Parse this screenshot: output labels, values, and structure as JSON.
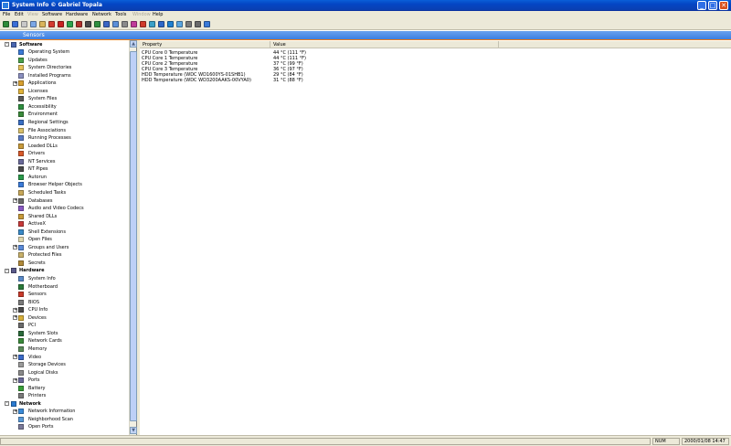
{
  "window": {
    "title": "System Info  © Gabriel Topala",
    "minimize": "_",
    "maximize": "□",
    "close": "✕"
  },
  "menu": [
    {
      "label": "File",
      "enabled": true
    },
    {
      "label": "Edit",
      "enabled": true
    },
    {
      "label": "View",
      "enabled": false
    },
    {
      "label": "Software",
      "enabled": true
    },
    {
      "label": "Hardware",
      "enabled": true
    },
    {
      "label": "Network",
      "enabled": true
    },
    {
      "label": "Tools",
      "enabled": true
    },
    {
      "label": "Window",
      "enabled": false
    },
    {
      "label": "Help",
      "enabled": true
    }
  ],
  "toolbar_icons": [
    {
      "name": "exit-icon",
      "color": "#2e8b3a"
    },
    {
      "name": "save-icon",
      "color": "#3b6fd6"
    },
    {
      "name": "cut-icon",
      "color": "#c8c8c8"
    },
    {
      "name": "copy-icon",
      "color": "#7aa7e6"
    },
    {
      "name": "paste-icon",
      "color": "#d9b45a"
    },
    {
      "name": "delete-icon",
      "color": "#d33b2f"
    },
    {
      "name": "stop-icon",
      "color": "#c82020"
    },
    {
      "name": "refresh-icon",
      "color": "#2aa34a"
    },
    {
      "name": "cpu-icon",
      "color": "#b0302a"
    },
    {
      "name": "chip-icon",
      "color": "#4a4a4a"
    },
    {
      "name": "memory-icon",
      "color": "#2f8f3f"
    },
    {
      "name": "display-icon",
      "color": "#3a66c4"
    },
    {
      "name": "network-icon",
      "color": "#5b8fd8"
    },
    {
      "name": "disk-icon",
      "color": "#8a8a8a"
    },
    {
      "name": "process-icon",
      "color": "#c03a9a"
    },
    {
      "name": "sensor-icon",
      "color": "#cf3a2a"
    },
    {
      "name": "gauge-icon",
      "color": "#3aa0c8"
    },
    {
      "name": "info-icon",
      "color": "#2d67c8"
    },
    {
      "name": "globe-icon",
      "color": "#1f7fd0"
    },
    {
      "name": "user-icon",
      "color": "#5aa5e0"
    },
    {
      "name": "settings-icon",
      "color": "#7a7a7a"
    },
    {
      "name": "printer-icon",
      "color": "#6a6a6a"
    },
    {
      "name": "help-icon",
      "color": "#3a7ad8"
    }
  ],
  "section_title": "Sensors",
  "tree": [
    {
      "label": "Software",
      "level": 0,
      "category": true,
      "expander": "-",
      "icon": "folder-software-icon",
      "color": "#4a66b0"
    },
    {
      "label": "Operating System",
      "level": 1,
      "icon": "windows-icon",
      "color": "#3c7ad6"
    },
    {
      "label": "Updates",
      "level": 1,
      "icon": "updates-icon",
      "color": "#4aa04a"
    },
    {
      "label": "System Directories",
      "level": 1,
      "icon": "folder-icon",
      "color": "#e6c25a"
    },
    {
      "label": "Installed Programs",
      "level": 1,
      "icon": "programs-icon",
      "color": "#8a8fbf"
    },
    {
      "label": "Applications",
      "level": 1,
      "expander": "+",
      "icon": "applications-icon",
      "color": "#d8a030"
    },
    {
      "label": "Licenses",
      "level": 1,
      "icon": "license-icon",
      "color": "#e0b23a"
    },
    {
      "label": "System Files",
      "level": 1,
      "icon": "system-files-icon",
      "color": "#5a5a5a"
    },
    {
      "label": "Accessibility",
      "level": 1,
      "icon": "accessibility-icon",
      "color": "#2f8f3f"
    },
    {
      "label": "Environment",
      "level": 1,
      "icon": "environment-icon",
      "color": "#3a8a3a"
    },
    {
      "label": "Regional Settings",
      "level": 1,
      "icon": "regional-icon",
      "color": "#3a6fc4"
    },
    {
      "label": "File Associations",
      "level": 1,
      "icon": "file-associations-icon",
      "color": "#d9c06a"
    },
    {
      "label": "Running Processes",
      "level": 1,
      "icon": "processes-icon",
      "color": "#5a7ac4"
    },
    {
      "label": "Loaded DLLs",
      "level": 1,
      "icon": "dll-icon",
      "color": "#c89a3a"
    },
    {
      "label": "Drivers",
      "level": 1,
      "icon": "drivers-icon",
      "color": "#d85a2a"
    },
    {
      "label": "NT Services",
      "level": 1,
      "icon": "services-icon",
      "color": "#6a6a9a"
    },
    {
      "label": "NT Pipes",
      "level": 1,
      "icon": "pipes-icon",
      "color": "#4a4a4a"
    },
    {
      "label": "Autorun",
      "level": 1,
      "icon": "autorun-icon",
      "color": "#2a9a4a"
    },
    {
      "label": "Browser Helper Objects",
      "level": 1,
      "icon": "browser-icon",
      "color": "#3a7ad8"
    },
    {
      "label": "Scheduled Tasks",
      "level": 1,
      "icon": "tasks-icon",
      "color": "#c8a85a"
    },
    {
      "label": "Databases",
      "level": 1,
      "expander": "+",
      "icon": "database-icon",
      "color": "#6a6a6a"
    },
    {
      "label": "Audio and Video Codecs",
      "level": 1,
      "icon": "codecs-icon",
      "color": "#8a5ac4"
    },
    {
      "label": "Shared DLLs",
      "level": 1,
      "icon": "shared-dll-icon",
      "color": "#c89a3a"
    },
    {
      "label": "ActiveX",
      "level": 1,
      "icon": "activex-icon",
      "color": "#c83a3a"
    },
    {
      "label": "Shell Extensions",
      "level": 1,
      "icon": "shell-icon",
      "color": "#3a8ac8"
    },
    {
      "label": "Open Files",
      "level": 1,
      "icon": "open-files-icon",
      "color": "#e0d8b0"
    },
    {
      "label": "Groups and Users",
      "level": 1,
      "expander": "+",
      "icon": "users-icon",
      "color": "#5a8ad8"
    },
    {
      "label": "Protected Files",
      "level": 1,
      "icon": "protected-icon",
      "color": "#c8b06a"
    },
    {
      "label": "Secrets",
      "level": 1,
      "icon": "secrets-icon",
      "color": "#b08a3a"
    },
    {
      "label": "Hardware",
      "level": 0,
      "category": true,
      "expander": "-",
      "icon": "hardware-icon",
      "color": "#5a5a8a"
    },
    {
      "label": "System Info",
      "level": 1,
      "icon": "system-info-icon",
      "color": "#5a8ac8"
    },
    {
      "label": "Motherboard",
      "level": 1,
      "icon": "motherboard-icon",
      "color": "#2a7a3a"
    },
    {
      "label": "Sensors",
      "level": 1,
      "icon": "sensors-icon",
      "color": "#c83a2a"
    },
    {
      "label": "BIOS",
      "level": 1,
      "icon": "bios-icon",
      "color": "#7a7a7a"
    },
    {
      "label": "CPU Info",
      "level": 1,
      "expander": "+",
      "icon": "cpu-info-icon",
      "color": "#4a4a4a"
    },
    {
      "label": "Devices",
      "level": 1,
      "expander": "+",
      "icon": "devices-icon",
      "color": "#d8b03a"
    },
    {
      "label": "PCI",
      "level": 1,
      "icon": "pci-icon",
      "color": "#6a6a6a"
    },
    {
      "label": "System Slots",
      "level": 1,
      "icon": "slots-icon",
      "color": "#2a6a3a"
    },
    {
      "label": "Network Cards",
      "level": 1,
      "icon": "network-card-icon",
      "color": "#3a8a3a"
    },
    {
      "label": "Memory",
      "level": 1,
      "icon": "memory-module-icon",
      "color": "#5a8a5a"
    },
    {
      "label": "Video",
      "level": 1,
      "expander": "+",
      "icon": "video-icon",
      "color": "#3a6ac8"
    },
    {
      "label": "Storage Devices",
      "level": 1,
      "icon": "storage-icon",
      "color": "#9a9a9a"
    },
    {
      "label": "Logical Disks",
      "level": 1,
      "icon": "logical-disk-icon",
      "color": "#8a8a8a"
    },
    {
      "label": "Ports",
      "level": 1,
      "expander": "+",
      "icon": "ports-icon",
      "color": "#6a6a9a"
    },
    {
      "label": "Battery",
      "level": 1,
      "icon": "battery-icon",
      "color": "#3aa03a"
    },
    {
      "label": "Printers",
      "level": 1,
      "icon": "printers-icon",
      "color": "#7a7a7a"
    },
    {
      "label": "Network",
      "level": 0,
      "category": true,
      "expander": "-",
      "icon": "network-globe-icon",
      "color": "#2a7ad0"
    },
    {
      "label": "Network Information",
      "level": 1,
      "expander": "+",
      "icon": "network-info-icon",
      "color": "#3a8ad8"
    },
    {
      "label": "Neighborhood Scan",
      "level": 1,
      "icon": "neighborhood-icon",
      "color": "#5a9ad8"
    },
    {
      "label": "Open Ports",
      "level": 1,
      "icon": "open-ports-icon",
      "color": "#7a7a9a"
    }
  ],
  "table": {
    "columns": [
      "Property",
      "Value"
    ],
    "rows": [
      {
        "property": "CPU Core 0 Temperature",
        "value": "44 °C (111 °F)"
      },
      {
        "property": "CPU Core 1 Temperature",
        "value": "44 °C (111 °F)"
      },
      {
        "property": "CPU Core 2 Temperature",
        "value": "37 °C (99 °F)"
      },
      {
        "property": "CPU Core 3 Temperature",
        "value": "36 °C (97 °F)"
      },
      {
        "property": "HDD Temperature (WDC WD1600YS-01SHB1)",
        "value": "29 °C (84 °F)"
      },
      {
        "property": "HDD Temperature (WDC WD3200AAKS-00VYA0)",
        "value": "31 °C (88 °F)"
      }
    ]
  },
  "status": {
    "num": "NUM",
    "datetime": "2000/01/08 14:47"
  },
  "colors": {
    "title_bar": "#0a5fd8",
    "header_strip": "#3d7fe0",
    "accent": "#f07b12",
    "chrome": "#ece9d8"
  }
}
